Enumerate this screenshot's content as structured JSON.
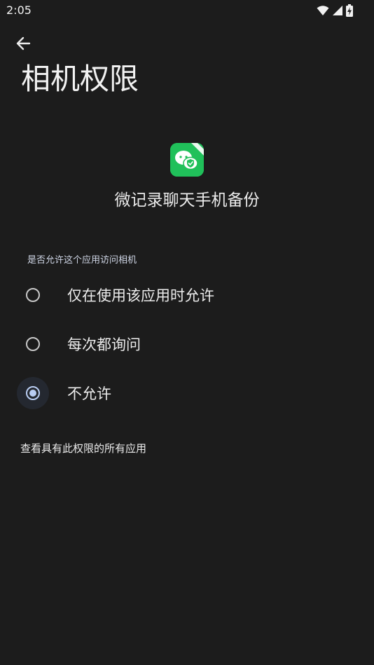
{
  "status_bar": {
    "time": "2:05"
  },
  "header": {
    "title": "相机权限"
  },
  "app": {
    "name": "微记录聊天手机备份",
    "icon_color": "#20c05a"
  },
  "section": {
    "label": "是否允许这个应用访问相机"
  },
  "options": [
    {
      "label": "仅在使用该应用时允许",
      "selected": false
    },
    {
      "label": "每次都询问",
      "selected": false
    },
    {
      "label": "不允许",
      "selected": true
    }
  ],
  "footer": {
    "link": "查看具有此权限的所有应用"
  },
  "colors": {
    "background": "#1c1c1c",
    "accent": "#b9cdf2"
  }
}
